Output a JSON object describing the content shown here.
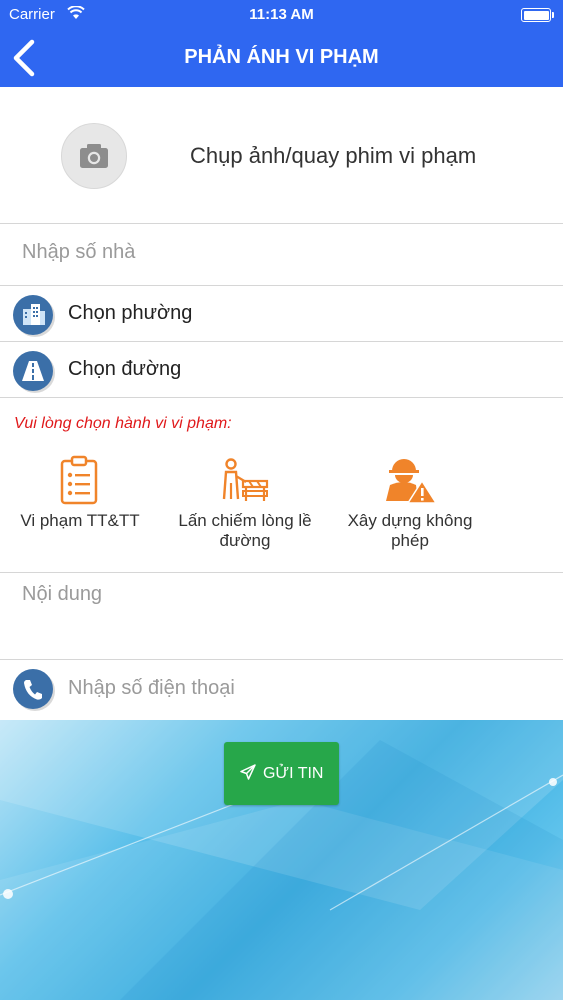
{
  "status_bar": {
    "carrier": "Carrier",
    "time": "11:13 AM"
  },
  "navbar": {
    "title": "PHẢN ÁNH VI PHẠM",
    "back_icon": "chevron-left-icon"
  },
  "media": {
    "label": "Chụp ảnh/quay phim vi phạm",
    "icon": "camera-icon"
  },
  "house_number": {
    "placeholder": "Nhập số nhà"
  },
  "ward": {
    "label": "Chọn phường",
    "icon": "building-icon"
  },
  "street": {
    "label": "Chọn đường",
    "icon": "road-icon"
  },
  "violation_prompt": "Vui lòng chọn hành vi vi phạm:",
  "categories": [
    {
      "label": "Vi phạm TT&TT",
      "icon": "clipboard-checklist-icon"
    },
    {
      "label": "Lấn chiếm lòng lề đường",
      "icon": "sidewalk-encroachment-icon"
    },
    {
      "label": "Xây dựng không phép",
      "icon": "construction-worker-warning-icon"
    }
  ],
  "content": {
    "placeholder": "Nội dung"
  },
  "phone": {
    "placeholder": "Nhập số điện thoại",
    "icon": "phone-icon"
  },
  "send_button": {
    "label": "GỬI TIN",
    "icon": "paper-plane-icon"
  },
  "colors": {
    "header": "#2f67f1",
    "send": "#27a74a",
    "prompt": "#e0191b",
    "category_icon": "#f0842a"
  }
}
